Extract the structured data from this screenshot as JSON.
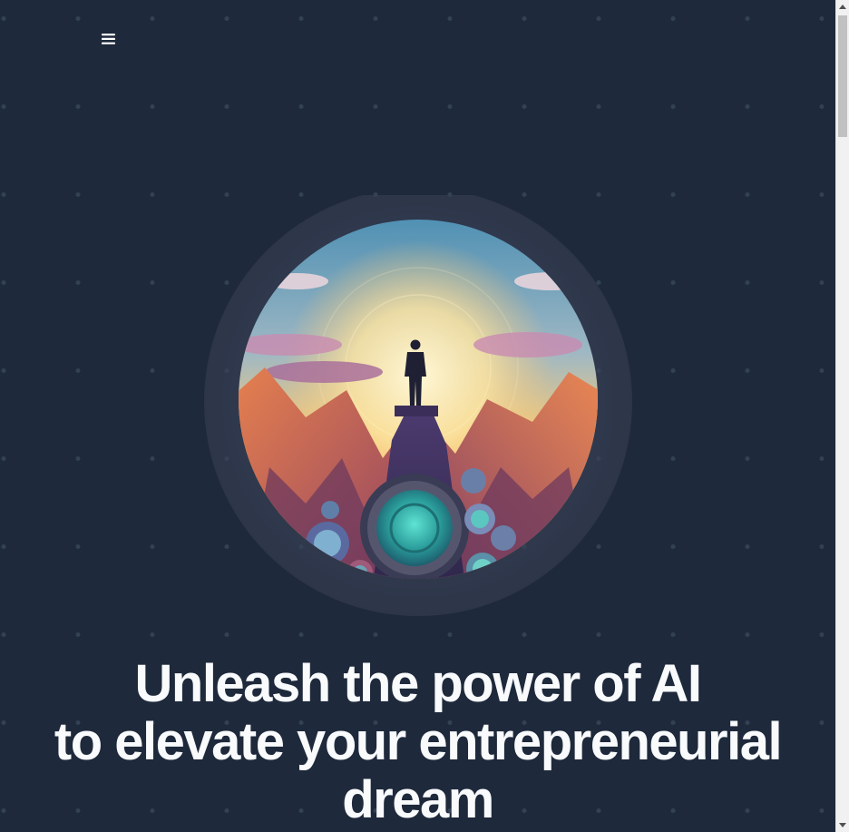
{
  "header": {
    "menu_icon": "hamburger-menu-icon"
  },
  "hero": {
    "illustration": "person-on-mountain-peak-with-gears-illustration",
    "headline_lines": [
      "Unleash the power of AI",
      "to elevate your entrepreneurial",
      "dream"
    ]
  },
  "colors": {
    "background": "#1e293b",
    "dots": "#334155",
    "headline": "#f8fafc"
  }
}
